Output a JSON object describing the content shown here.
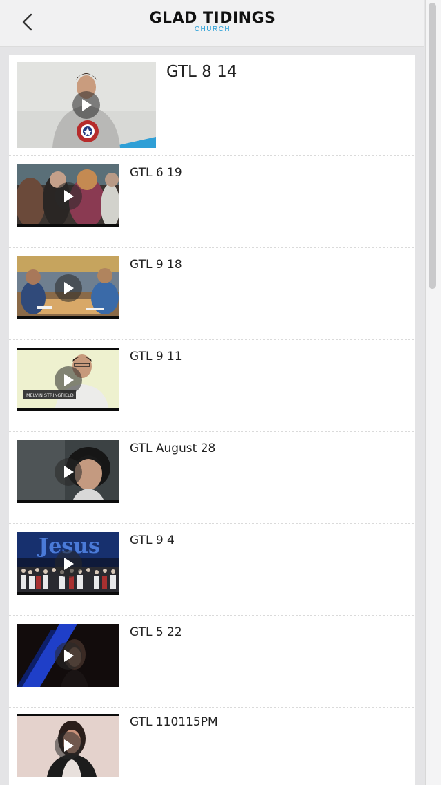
{
  "header": {
    "title": "GLAD TIDINGS",
    "subtitle": "CHURCH"
  },
  "videos": [
    {
      "title": "GTL 8 14"
    },
    {
      "title": "GTL 6 19"
    },
    {
      "title": "GTL 9 18"
    },
    {
      "title": "GTL 9 11"
    },
    {
      "title": "GTL August 28"
    },
    {
      "title": "GTL 9 4"
    },
    {
      "title": "GTL 5 22"
    },
    {
      "title": "GTL 110115PM"
    }
  ],
  "thumbnail_overlays": {
    "nameplate": "MELVIN STRINGFIELD",
    "banner_word": "Jesus"
  },
  "colors": {
    "accent": "#2aa0d8"
  }
}
